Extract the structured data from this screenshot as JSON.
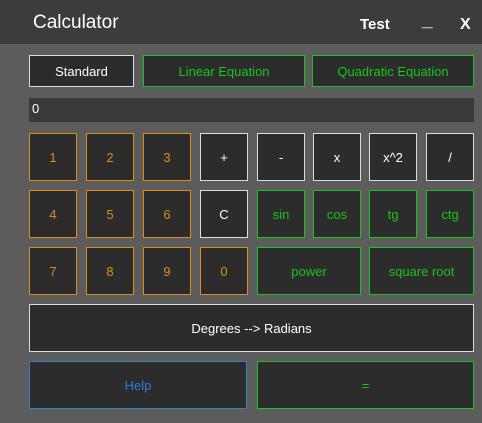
{
  "window": {
    "title": "Calculator",
    "test_label": "Test",
    "minimize_label": "_",
    "close_label": "X"
  },
  "modes": {
    "standard": "Standard",
    "linear": "Linear Equation",
    "quadratic": "Quadratic Equation"
  },
  "display": {
    "value": "0"
  },
  "keys": {
    "d1": "1",
    "d2": "2",
    "d3": "3",
    "d4": "4",
    "d5": "5",
    "d6": "6",
    "d7": "7",
    "d8": "8",
    "d9": "9",
    "d0": "0",
    "plus": "+",
    "minus": "-",
    "multiply": "x",
    "square": "x^2",
    "divide": "/",
    "clear": "C",
    "sin": "sin",
    "cos": "cos",
    "tg": "tg",
    "ctg": "ctg",
    "power": "power",
    "sqrt": "square root",
    "deg_rad": "Degrees --> Radians",
    "help": "Help",
    "equals": "="
  },
  "colors": {
    "digit": "#e08a1e",
    "function": "#19c519",
    "operator": "#ffffff",
    "help": "#2f7fd6",
    "button_bg": "#2c2c2c",
    "window_bg": "#5c5c5c",
    "titlebar_bg": "#3c3c3c"
  }
}
